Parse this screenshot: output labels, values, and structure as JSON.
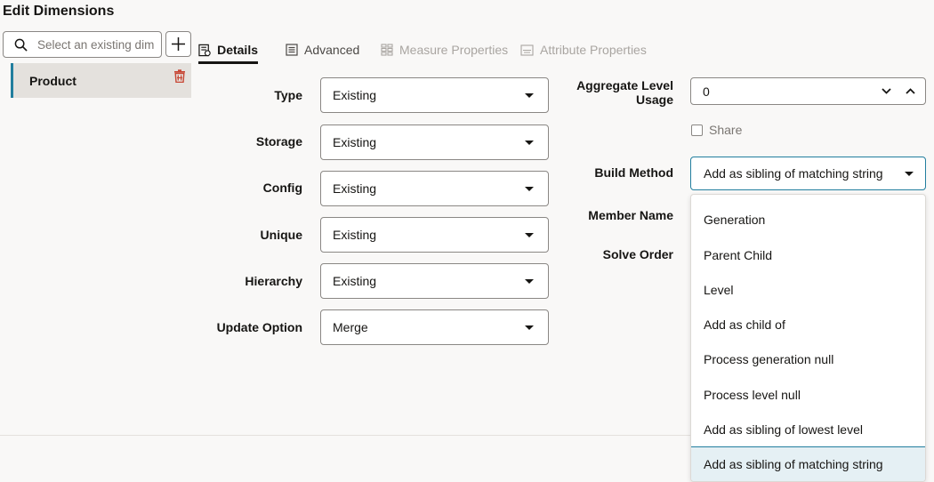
{
  "page": {
    "title": "Edit Dimensions"
  },
  "search": {
    "placeholder": "Select an existing dim",
    "value": ""
  },
  "dimensions": [
    {
      "label": "Product"
    }
  ],
  "tabs": [
    {
      "label": "Details",
      "state": "active",
      "icon": "details-icon"
    },
    {
      "label": "Advanced",
      "state": "normal",
      "icon": "advanced-icon"
    },
    {
      "label": "Measure Properties",
      "state": "disabled",
      "icon": "measure-properties-icon"
    },
    {
      "label": "Attribute Properties",
      "state": "disabled",
      "icon": "attribute-properties-icon"
    }
  ],
  "fields": {
    "type": {
      "label": "Type",
      "value": "Existing"
    },
    "storage": {
      "label": "Storage",
      "value": "Existing"
    },
    "config": {
      "label": "Config",
      "value": "Existing"
    },
    "unique": {
      "label": "Unique",
      "value": "Existing"
    },
    "hierarchy": {
      "label": "Hierarchy",
      "value": "Existing"
    },
    "update_option": {
      "label": "Update Option",
      "value": "Merge"
    },
    "aggregate_level_usage": {
      "label_line1": "Aggregate Level",
      "label_line2": "Usage",
      "value": "0"
    },
    "share": {
      "label": "Share",
      "checked": false
    },
    "build_method": {
      "label": "Build Method",
      "value": "Add as sibling of matching string"
    },
    "member_name": {
      "label": "Member Name"
    },
    "solve_order": {
      "label": "Solve Order"
    }
  },
  "build_method_options": [
    "Generation",
    "Parent Child",
    "Level",
    "Add as child of",
    "Process generation null",
    "Process level null",
    "Add as sibling of lowest level",
    "Add as sibling of matching string"
  ],
  "colors": {
    "accent": "#227e9e",
    "danger": "#c74634",
    "selected_bg": "#e5f0f4",
    "panel_bg": "#e4e1dd"
  }
}
